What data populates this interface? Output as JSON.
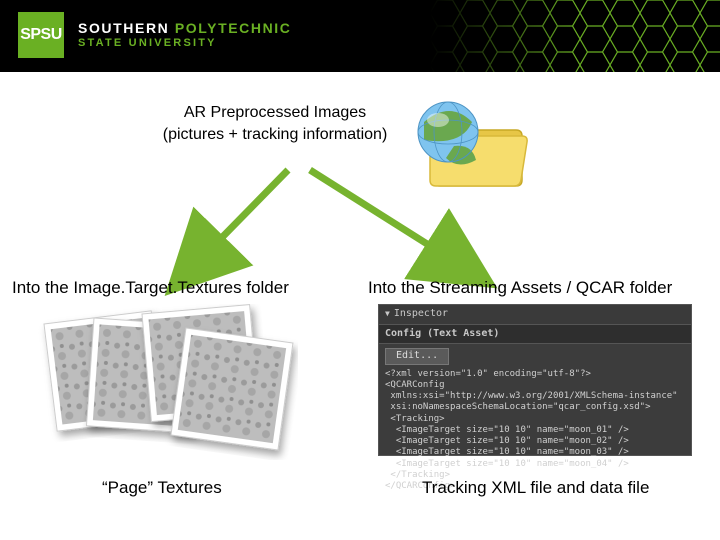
{
  "header": {
    "badge": "SPSU",
    "line1a": "SOUTHERN ",
    "line1b": "POLYTECHNIC",
    "line2": "STATE UNIVERSITY"
  },
  "top_caption_l1": "AR Preprocessed Images",
  "top_caption_l2": "(pictures + tracking information)",
  "left_column_title": "Into the Image.Target.Textures folder",
  "right_column_title": "Into the Streaming Assets / QCAR folder",
  "left_bottom_caption": "“Page” Textures",
  "right_bottom_caption": "Tracking XML file and data file",
  "inspector": {
    "head": "Inspector",
    "title": "Config (Text Asset)",
    "edit_button": "Edit...",
    "xml": "<?xml version=\"1.0\" encoding=\"utf-8\"?>\n<QCARConfig\n xmlns:xsi=\"http://www.w3.org/2001/XMLSchema-instance\"\n xsi:noNamespaceSchemaLocation=\"qcar_config.xsd\">\n <Tracking>\n  <ImageTarget size=\"10 10\" name=\"moon_01\" />\n  <ImageTarget size=\"10 10\" name=\"moon_02\" />\n  <ImageTarget size=\"10 10\" name=\"moon_03\" />\n  <ImageTarget size=\"10 10\" name=\"moon_04\" />\n </Tracking>\n</QCARConfig>"
  },
  "icons": {
    "globe_folder": "globe-folder-icon"
  },
  "colors": {
    "brand_green": "#6ab023",
    "arrow_green": "#77b32f",
    "panel_bg": "#3c3c3c"
  }
}
